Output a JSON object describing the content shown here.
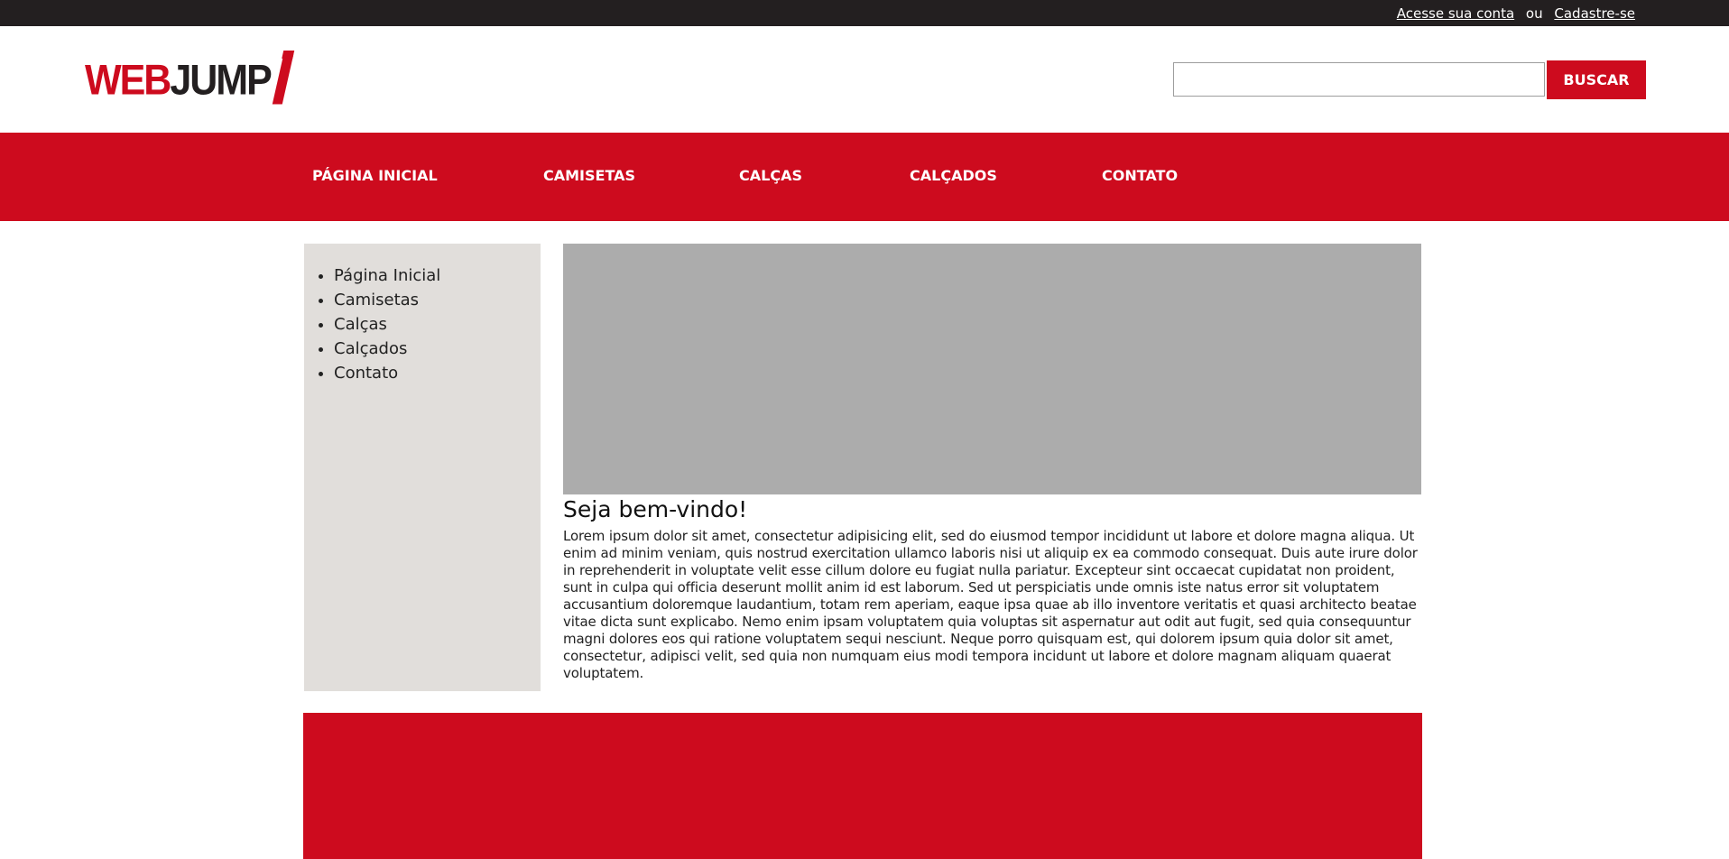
{
  "topbar": {
    "login_link": "Acesse sua conta",
    "separator": "ou",
    "register_link": "Cadastre-se"
  },
  "header": {
    "logo_text_web": "WEB",
    "logo_text_jump": "JUMP",
    "search": {
      "value": "",
      "placeholder": "",
      "button_label": "BUSCAR"
    }
  },
  "nav": {
    "items": [
      {
        "label": "PÁGINA INICIAL"
      },
      {
        "label": "CAMISETAS"
      },
      {
        "label": "CALÇAS"
      },
      {
        "label": "CALÇADOS"
      },
      {
        "label": "CONTATO"
      }
    ]
  },
  "sidebar": {
    "items": [
      {
        "label": "Página Inicial"
      },
      {
        "label": "Camisetas"
      },
      {
        "label": "Calças"
      },
      {
        "label": "Calçados"
      },
      {
        "label": "Contato"
      }
    ]
  },
  "main": {
    "title": "Seja bem-vindo!",
    "body": "Lorem ipsum dolor sit amet, consectetur adipisicing elit, sed do eiusmod tempor incididunt ut labore et dolore magna aliqua. Ut enim ad minim veniam, quis nostrud exercitation ullamco laboris nisi ut aliquip ex ea commodo consequat. Duis aute irure dolor in reprehenderit in voluptate velit esse cillum dolore eu fugiat nulla pariatur. Excepteur sint occaecat cupidatat non proident, sunt in culpa qui officia deserunt mollit anim id est laborum. Sed ut perspiciatis unde omnis iste natus error sit voluptatem accusantium doloremque laudantium, totam rem aperiam, eaque ipsa quae ab illo inventore veritatis et quasi architecto beatae vitae dicta sunt explicabo. Nemo enim ipsam voluptatem quia voluptas sit aspernatur aut odit aut fugit, sed quia consequuntur magni dolores eos qui ratione voluptatem sequi nesciunt. Neque porro quisquam est, qui dolorem ipsum quia dolor sit amet, consectetur, adipisci velit, sed quia non numquam eius modi tempora incidunt ut labore et dolore magnam aliquam quaerat voluptatem."
  },
  "colors": {
    "brand_red": "#cd0b1e",
    "topbar_dark": "#231f20",
    "sidebar_gray": "#e1dedb",
    "banner_gray": "#acacac"
  }
}
